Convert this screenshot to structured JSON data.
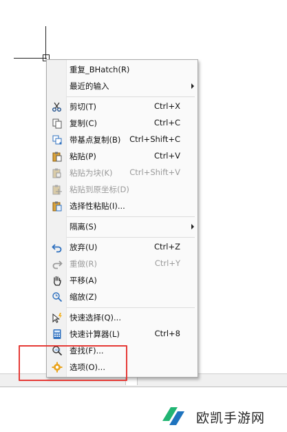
{
  "menu": {
    "items": [
      {
        "label": "重复_BHatch(R)",
        "shortcut": "",
        "icon": "none",
        "disabled": false
      },
      {
        "label": "最近的输入",
        "shortcut": "",
        "icon": "none",
        "disabled": false,
        "submenu": true
      },
      {
        "label": "剪切(T)",
        "shortcut": "Ctrl+X",
        "icon": "scissors-icon",
        "disabled": false
      },
      {
        "label": "复制(C)",
        "shortcut": "Ctrl+C",
        "icon": "copy-icon",
        "disabled": false
      },
      {
        "label": "带基点复制(B)",
        "shortcut": "Ctrl+Shift+C",
        "icon": "copy-base-point-icon",
        "disabled": false
      },
      {
        "label": "粘贴(P)",
        "shortcut": "Ctrl+V",
        "icon": "paste-icon",
        "disabled": false
      },
      {
        "label": "粘贴为块(K)",
        "shortcut": "Ctrl+Shift+V",
        "icon": "paste-as-block-icon",
        "disabled": true
      },
      {
        "label": "粘贴到原坐标(D)",
        "shortcut": "",
        "icon": "paste-original-coords-icon",
        "disabled": true
      },
      {
        "label": "选择性粘贴(I)...",
        "shortcut": "",
        "icon": "paste-special-icon",
        "disabled": false
      },
      {
        "label": "隔离(S)",
        "shortcut": "",
        "icon": "none",
        "disabled": false,
        "submenu": true
      },
      {
        "label": "放弃(U)",
        "shortcut": "Ctrl+Z",
        "icon": "undo-icon",
        "disabled": false
      },
      {
        "label": "重做(R)",
        "shortcut": "Ctrl+Y",
        "icon": "redo-icon",
        "disabled": true
      },
      {
        "label": "平移(A)",
        "shortcut": "",
        "icon": "pan-hand-icon",
        "disabled": false
      },
      {
        "label": "缩放(Z)",
        "shortcut": "",
        "icon": "zoom-icon",
        "disabled": false
      },
      {
        "label": "快速选择(Q)...",
        "shortcut": "",
        "icon": "quick-select-icon",
        "disabled": false
      },
      {
        "label": "快速计算器(L)",
        "shortcut": "Ctrl+8",
        "icon": "calculator-icon",
        "disabled": false
      },
      {
        "label": "查找(F)...",
        "shortcut": "",
        "icon": "find-icon",
        "disabled": false
      },
      {
        "label": "选项(O)...",
        "shortcut": "",
        "icon": "options-gear-icon",
        "disabled": false
      }
    ]
  },
  "watermark": {
    "brand": "欧凯手游网"
  },
  "colors": {
    "highlight_box": "#e53935",
    "logo_green": "#21b573",
    "logo_blue": "#1e73be",
    "disabled_text": "#9a9a9a"
  }
}
